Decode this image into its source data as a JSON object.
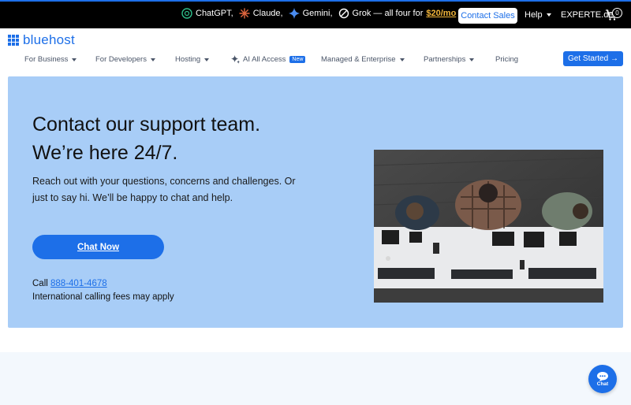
{
  "promo": {
    "items": [
      "ChatGPT,",
      "Claude,",
      "Gemini,",
      "Grok — all four for"
    ],
    "price": "$20/mo",
    "contact_sales": "Contact Sales",
    "help": "Help",
    "site": "EXPERTE.de",
    "cart_count": "0"
  },
  "header": {
    "logo": "bluehost",
    "nav": [
      "For Business",
      "For Developers",
      "Hosting",
      "AI All Access",
      "Managed & Enterprise",
      "Partnerships",
      "Pricing"
    ],
    "new_badge": "New",
    "get_started": "Get Started →"
  },
  "hero": {
    "title_line1": "Contact our support team.",
    "title_line2": "We’re here 24/7.",
    "subtitle": "Reach out with your questions, concerns and challenges. Or just to say hi. We’ll be happy to chat and help.",
    "chat_button": "Chat Now",
    "call_prefix": "Call",
    "phone": "888-401-4678",
    "fees_note": "International calling fees may apply"
  },
  "chat_widget": {
    "label": "Chat"
  },
  "colors": {
    "brand": "#1d6fe8",
    "hero_bg": "#a8cdf7",
    "price": "#f4b73b"
  }
}
